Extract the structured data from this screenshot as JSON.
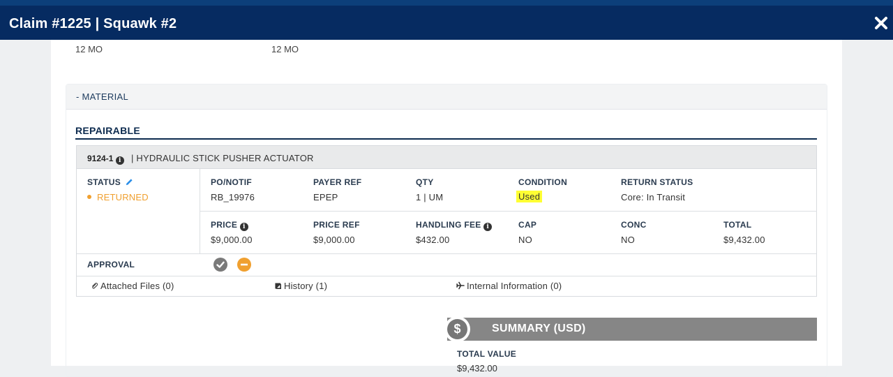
{
  "window": {
    "title": "Claim #1225 | Squawk #2"
  },
  "warranty": {
    "left_value": "12 MO",
    "right_value": "12 MO"
  },
  "material": {
    "section_label": "- MATERIAL",
    "subsection_title": "REPAIRABLE",
    "part": {
      "number": "9124-1",
      "separator": "|",
      "description": "HYDRAULIC STICK PUSHER ACTUATOR"
    },
    "status": {
      "label": "STATUS",
      "value": "RETURNED"
    },
    "row1": {
      "po_notif": {
        "label": "PO/NOTIF",
        "value": "RB_19976"
      },
      "payer_ref": {
        "label": "PAYER REF",
        "value": "EPEP"
      },
      "qty": {
        "label": "QTY",
        "value": "1 | UM"
      },
      "condition": {
        "label": "CONDITION",
        "value": "Used"
      },
      "return_status": {
        "label": "RETURN STATUS",
        "value": "Core: In Transit"
      }
    },
    "row2": {
      "price": {
        "label": "PRICE",
        "value": "$9,000.00"
      },
      "price_ref": {
        "label": "PRICE REF",
        "value": "$9,000.00"
      },
      "handling_fee": {
        "label": "HANDLING FEE",
        "value": "$432.00"
      },
      "cap": {
        "label": "CAP",
        "value": "NO"
      },
      "conc": {
        "label": "CONC",
        "value": "NO"
      },
      "total": {
        "label": "TOTAL",
        "value": "$9,432.00"
      }
    },
    "approval": {
      "label": "APPROVAL"
    },
    "links": {
      "attached_files": "Attached Files (0)",
      "history": "History (1)",
      "internal_information": "Internal Information (0)"
    }
  },
  "summary": {
    "title": "SUMMARY (USD)",
    "total_value_label": "TOTAL VALUE",
    "total_value": "$9,432.00"
  },
  "colors": {
    "header_bg": "#062b61",
    "status_returned": "#f0a030",
    "highlight": "#ffff33",
    "summary_bg": "#868686"
  }
}
